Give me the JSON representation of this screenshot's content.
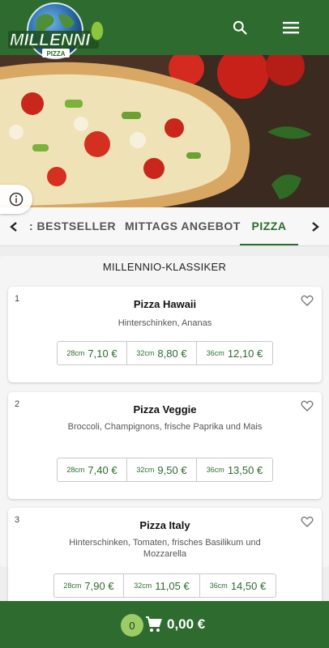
{
  "header": {
    "logo_text": "MILLENNI",
    "logo_subtext": "PIZZA",
    "search_icon": "search-icon",
    "menu_icon": "hamburger-menu-icon"
  },
  "hero": {
    "info_icon": "info-icon"
  },
  "tabs": [
    {
      "label": ": BESTSELLER"
    },
    {
      "label": "MITTAGS ANGEBOT"
    },
    {
      "label": "PIZZA"
    }
  ],
  "active_tab": "PIZZA",
  "section": {
    "title": "MILLENNIO-KLASSIKER"
  },
  "products": [
    {
      "number": "1",
      "name": "Pizza Hawaii",
      "description": "Hinterschinken, Ananas",
      "prices": [
        {
          "size": "28cm",
          "value": "7,10 €"
        },
        {
          "size": "32cm",
          "value": "8,80 €"
        },
        {
          "size": "36cm",
          "value": "12,10 €"
        }
      ]
    },
    {
      "number": "2",
      "name": "Pizza Veggie",
      "description": "Broccoli, Champignons, frische Paprika und Mais",
      "prices": [
        {
          "size": "28cm",
          "value": "7,40 €"
        },
        {
          "size": "32cm",
          "value": "9,50 €"
        },
        {
          "size": "36cm",
          "value": "13,50 €"
        }
      ]
    },
    {
      "number": "3",
      "name": "Pizza Italy",
      "description": "Hinterschinken, Tomaten, frisches Basilikum und Mozzarella",
      "prices": [
        {
          "size": "28cm",
          "value": "7,90 €"
        },
        {
          "size": "32cm",
          "value": "11,05 €"
        },
        {
          "size": "36cm",
          "value": "14,50 €"
        }
      ]
    }
  ],
  "cart": {
    "count": "0",
    "total": "0,00 €",
    "icon": "shopping-cart-icon"
  },
  "colors": {
    "brand_green": "#2e6b2f",
    "badge_green": "#9ccc65"
  }
}
